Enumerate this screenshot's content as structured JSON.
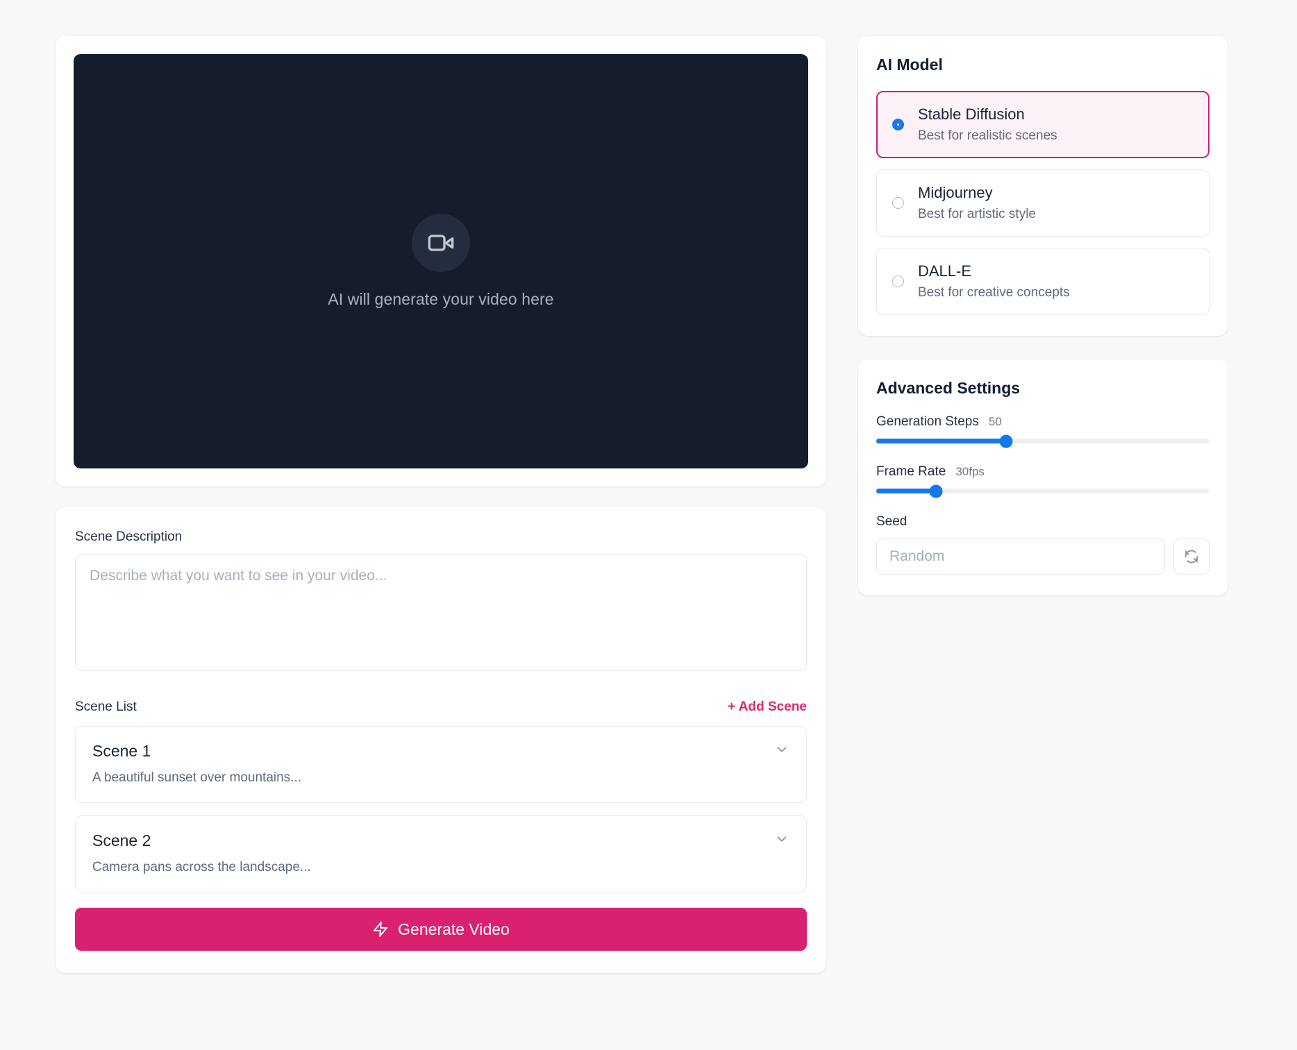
{
  "preview": {
    "placeholder_text": "AI will generate your video here",
    "icon": "video-camera-icon",
    "background_color": "#151c2c"
  },
  "form": {
    "scene_description_label": "Scene Description",
    "scene_description_placeholder": "Describe what you want to see in your video...",
    "scene_description_value": "",
    "scene_list_label": "Scene List",
    "add_scene_label": "+ Add Scene",
    "add_scene_color": "#dc2a74",
    "scenes": [
      {
        "title": "Scene 1",
        "description": "A beautiful sunset over mountains...",
        "chevron": "chevron-down-icon"
      },
      {
        "title": "Scene 2",
        "description": "Camera pans across the landscape...",
        "chevron": "chevron-down-icon"
      }
    ],
    "generate_button_label": "Generate Video",
    "generate_button_icon": "lightning-bolt-icon",
    "generate_button_color": "#d9216f"
  },
  "ai_model": {
    "title": "AI Model",
    "selected_index": 0,
    "selected_border_color": "#cf1f74",
    "selected_background_color": "#fdf2f7",
    "radio_active_color": "#1877e8",
    "options": [
      {
        "name": "Stable Diffusion",
        "description": "Best for realistic scenes",
        "selected": true
      },
      {
        "name": "Midjourney",
        "description": "Best for artistic style",
        "selected": false
      },
      {
        "name": "DALL-E",
        "description": "Best for creative concepts",
        "selected": false
      }
    ]
  },
  "advanced_settings": {
    "title": "Advanced Settings",
    "slider_color": "#1578ed",
    "generation_steps": {
      "label": "Generation Steps",
      "value": "50",
      "percent": 39
    },
    "frame_rate": {
      "label": "Frame Rate",
      "value": "30fps",
      "percent": 18
    },
    "seed": {
      "label": "Seed",
      "placeholder": "Random",
      "value": "",
      "refresh_icon": "refresh-icon"
    }
  }
}
